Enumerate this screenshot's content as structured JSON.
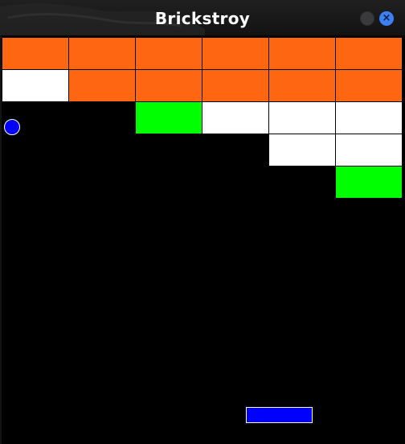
{
  "window": {
    "title": "Brickstroy"
  },
  "controls": {
    "minimize_icon": "circle",
    "close_icon": "×"
  },
  "colors": {
    "orange_brick": "#ff6611",
    "white_brick": "#ffffff",
    "green_brick": "#00ff00",
    "ball": "#0000ff",
    "paddle": "#0000ff",
    "background": "#000000",
    "close_button": "#3d7ff5"
  },
  "game": {
    "grid_columns": 6,
    "grid_rows": 5,
    "bricks": [
      [
        "orange",
        "orange",
        "orange",
        "orange",
        "orange",
        "orange"
      ],
      [
        "white",
        "orange",
        "orange",
        "orange",
        "orange",
        "orange"
      ],
      [
        null,
        null,
        "green",
        "white",
        "white",
        "white"
      ],
      [
        null,
        null,
        null,
        null,
        "white",
        "white"
      ],
      [
        null,
        null,
        null,
        null,
        null,
        "green"
      ]
    ]
  }
}
